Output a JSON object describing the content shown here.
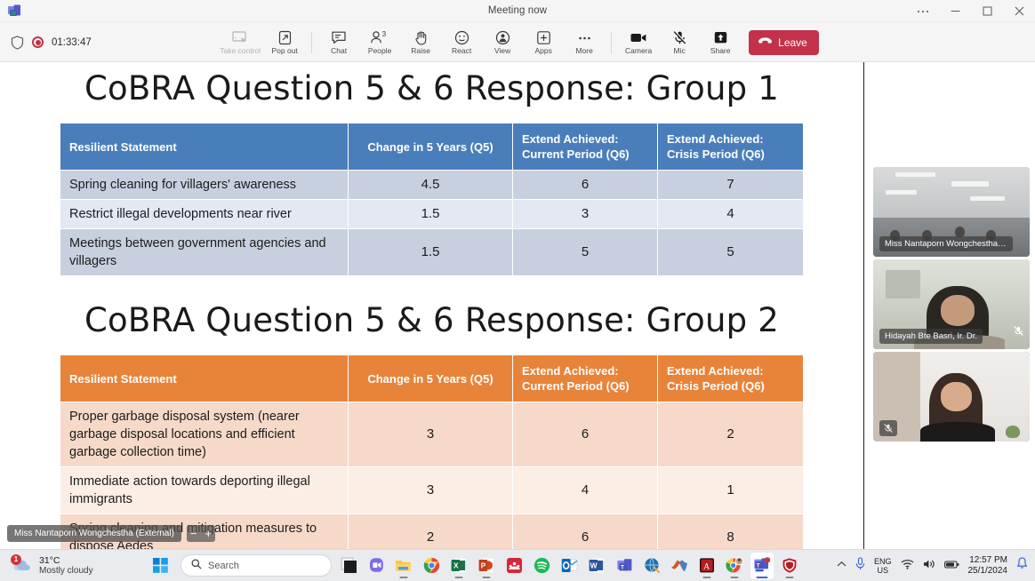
{
  "window": {
    "app_icon": "teams-icon",
    "title": "Meeting now",
    "controls": {
      "more": "…",
      "minimize": "—",
      "maximize": "▢",
      "close": "✕"
    }
  },
  "meeting_toolbar": {
    "shield_icon": "shield-icon",
    "recording_icon": "recording-dot-icon",
    "recording_time": "01:33:47",
    "tools": [
      {
        "name": "take-control",
        "label": "Take control",
        "icon": "take-control-icon",
        "disabled": true
      },
      {
        "name": "pop-out",
        "label": "Pop out",
        "icon": "pop-out-icon",
        "disabled": false
      },
      {
        "name": "chat",
        "label": "Chat",
        "icon": "chat-icon",
        "disabled": false
      },
      {
        "name": "people",
        "label": "People",
        "icon": "people-icon",
        "badge": "3",
        "disabled": false
      },
      {
        "name": "raise",
        "label": "Raise",
        "icon": "raise-hand-icon",
        "disabled": false
      },
      {
        "name": "react",
        "label": "React",
        "icon": "react-smiley-icon",
        "disabled": false
      },
      {
        "name": "view",
        "label": "View",
        "icon": "view-icon",
        "disabled": false
      },
      {
        "name": "apps",
        "label": "Apps",
        "icon": "apps-plus-icon",
        "disabled": false
      },
      {
        "name": "more",
        "label": "More",
        "icon": "more-ellipsis-icon",
        "disabled": false
      },
      {
        "name": "camera",
        "label": "Camera",
        "icon": "camera-icon",
        "disabled": false
      },
      {
        "name": "mic",
        "label": "Mic",
        "icon": "mic-muted-icon",
        "disabled": false
      },
      {
        "name": "share",
        "label": "Share",
        "icon": "share-screen-icon",
        "disabled": false
      }
    ],
    "leave": {
      "label": "Leave",
      "icon": "hangup-icon",
      "color": "#C4314B"
    }
  },
  "stage": {
    "presenter_chip": "Miss Nantaporn Wongchestha (External)",
    "zoom_out_label": "−",
    "zoom_in_label": "+",
    "slides": [
      {
        "title": "CoBRA Question 5 & 6 Response: Group 1",
        "accent": "#4A7EBB",
        "columns": [
          "Resilient Statement",
          "Change in 5 Years (Q5)",
          "Extend Achieved: Current Period (Q6)",
          "Extend Achieved: Crisis Period (Q6)"
        ],
        "column_lines": [
          [
            "Resilient Statement"
          ],
          [
            "Change in 5 Years (Q5)"
          ],
          [
            "Extend Achieved:",
            "Current Period (Q6)"
          ],
          [
            "Extend Achieved:",
            "Crisis Period (Q6)"
          ]
        ],
        "rows": [
          {
            "statement": "Spring cleaning for villagers' awareness",
            "q5": "4.5",
            "current": "6",
            "crisis": "7"
          },
          {
            "statement": "Restrict illegal developments near river",
            "q5": "1.5",
            "current": "3",
            "crisis": "4"
          },
          {
            "statement": "Meetings between government agencies and villagers",
            "q5": "1.5",
            "current": "5",
            "crisis": "5"
          }
        ]
      },
      {
        "title": "CoBRA Question 5 & 6 Response: Group 2",
        "accent": "#E8833A",
        "columns": [
          "Resilient Statement",
          "Change in 5 Years (Q5)",
          "Extend Achieved: Current Period (Q6)",
          "Extend Achieved: Crisis Period (Q6)"
        ],
        "column_lines": [
          [
            "Resilient Statement"
          ],
          [
            "Change in 5 Years (Q5)"
          ],
          [
            "Extend Achieved:",
            "Current Period (Q6)"
          ],
          [
            "Extend Achieved:",
            "Crisis Period (Q6)"
          ]
        ],
        "rows": [
          {
            "statement": "Proper garbage disposal system (nearer garbage disposal locations and efficient garbage collection time)",
            "q5": "3",
            "current": "6",
            "crisis": "2"
          },
          {
            "statement": "Immediate action towards deporting illegal immigrants",
            "q5": "3",
            "current": "4",
            "crisis": "1"
          },
          {
            "statement": "Spring cleaning and mitigation measures to dispose Aedes",
            "q5": "2",
            "current": "6",
            "crisis": "8"
          }
        ]
      }
    ]
  },
  "video_rail": {
    "tiles": [
      {
        "name": "Miss Nantaporn Wongchestha (Exte...",
        "muted": false,
        "show_name": true
      },
      {
        "name": "Hidayah Bte Basri, Ir. Dr.",
        "muted": true,
        "show_name": true
      },
      {
        "name": "",
        "muted": true,
        "show_name": false
      }
    ]
  },
  "taskbar": {
    "weather": {
      "temperature": "31°C",
      "description": "Mostly cloudy",
      "badge": "1",
      "icon": "cloud-icon"
    },
    "start_icon": "windows-start-icon",
    "search": {
      "placeholder": "Search",
      "icon": "search-icon"
    },
    "apps": [
      {
        "name": "task-view",
        "icon": "task-view-icon",
        "running": false
      },
      {
        "name": "skype",
        "icon": "skype-video-icon",
        "running": false
      },
      {
        "name": "file-explorer",
        "icon": "folder-icon",
        "running": true
      },
      {
        "name": "chrome",
        "icon": "chrome-icon",
        "running": false
      },
      {
        "name": "excel",
        "icon": "excel-icon",
        "running": true
      },
      {
        "name": "powerpoint",
        "icon": "powerpoint-icon",
        "running": true
      },
      {
        "name": "mendeley",
        "icon": "mendeley-icon",
        "running": false
      },
      {
        "name": "spotify",
        "icon": "spotify-icon",
        "running": false
      },
      {
        "name": "outlook",
        "icon": "outlook-icon",
        "running": false
      },
      {
        "name": "word",
        "icon": "word-icon",
        "running": false
      },
      {
        "name": "teams-classic",
        "icon": "teams-icon",
        "running": false
      },
      {
        "name": "search-globe",
        "icon": "globe-search-icon",
        "running": false
      },
      {
        "name": "matlab",
        "icon": "matlab-icon",
        "running": false
      },
      {
        "name": "acrobat",
        "icon": "acrobat-icon",
        "running": true
      },
      {
        "name": "chrome-profile",
        "icon": "chrome-profile-icon",
        "running": true
      },
      {
        "name": "teams-new",
        "icon": "teams-new-icon",
        "running": true,
        "active": true
      },
      {
        "name": "mcafee",
        "icon": "mcafee-shield-icon",
        "running": true
      }
    ],
    "tray": {
      "chevron_icon": "chevron-up-icon",
      "mic_icon": "mic-icon",
      "language": {
        "line1": "ENG",
        "line2": "US"
      },
      "wifi_icon": "wifi-icon",
      "volume_icon": "volume-icon",
      "battery_icon": "battery-icon",
      "time": "12:57 PM",
      "date": "25/1/2024",
      "notification_icon": "bell-icon"
    }
  }
}
